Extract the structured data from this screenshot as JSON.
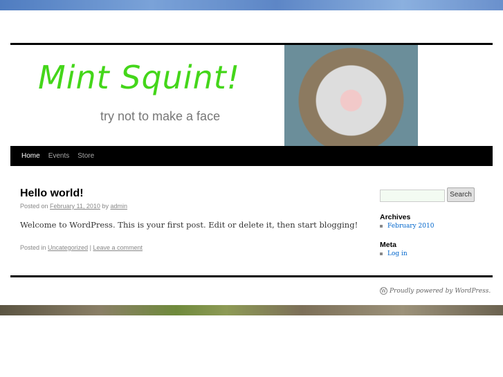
{
  "site": {
    "title": "Mint Squint!",
    "tagline": "try not to make a face"
  },
  "nav": [
    {
      "label": "Home"
    },
    {
      "label": "Events"
    },
    {
      "label": "Store"
    }
  ],
  "post": {
    "title": "Hello world!",
    "posted_on": "Posted on",
    "date": "February 11, 2010",
    "by": "by",
    "author": "admin",
    "content": "Welcome to WordPress. This is your first post. Edit or delete it, then start blogging!",
    "posted_in": "Posted in",
    "category": "Uncategorized",
    "sep": "|",
    "comment": "Leave a comment"
  },
  "sidebar": {
    "search_value": "",
    "search_button": "Search",
    "archives_title": "Archives",
    "archives": [
      "February 2010"
    ],
    "meta_title": "Meta",
    "meta": [
      "Log in"
    ]
  },
  "footer": {
    "credit": "Proudly powered by WordPress."
  }
}
